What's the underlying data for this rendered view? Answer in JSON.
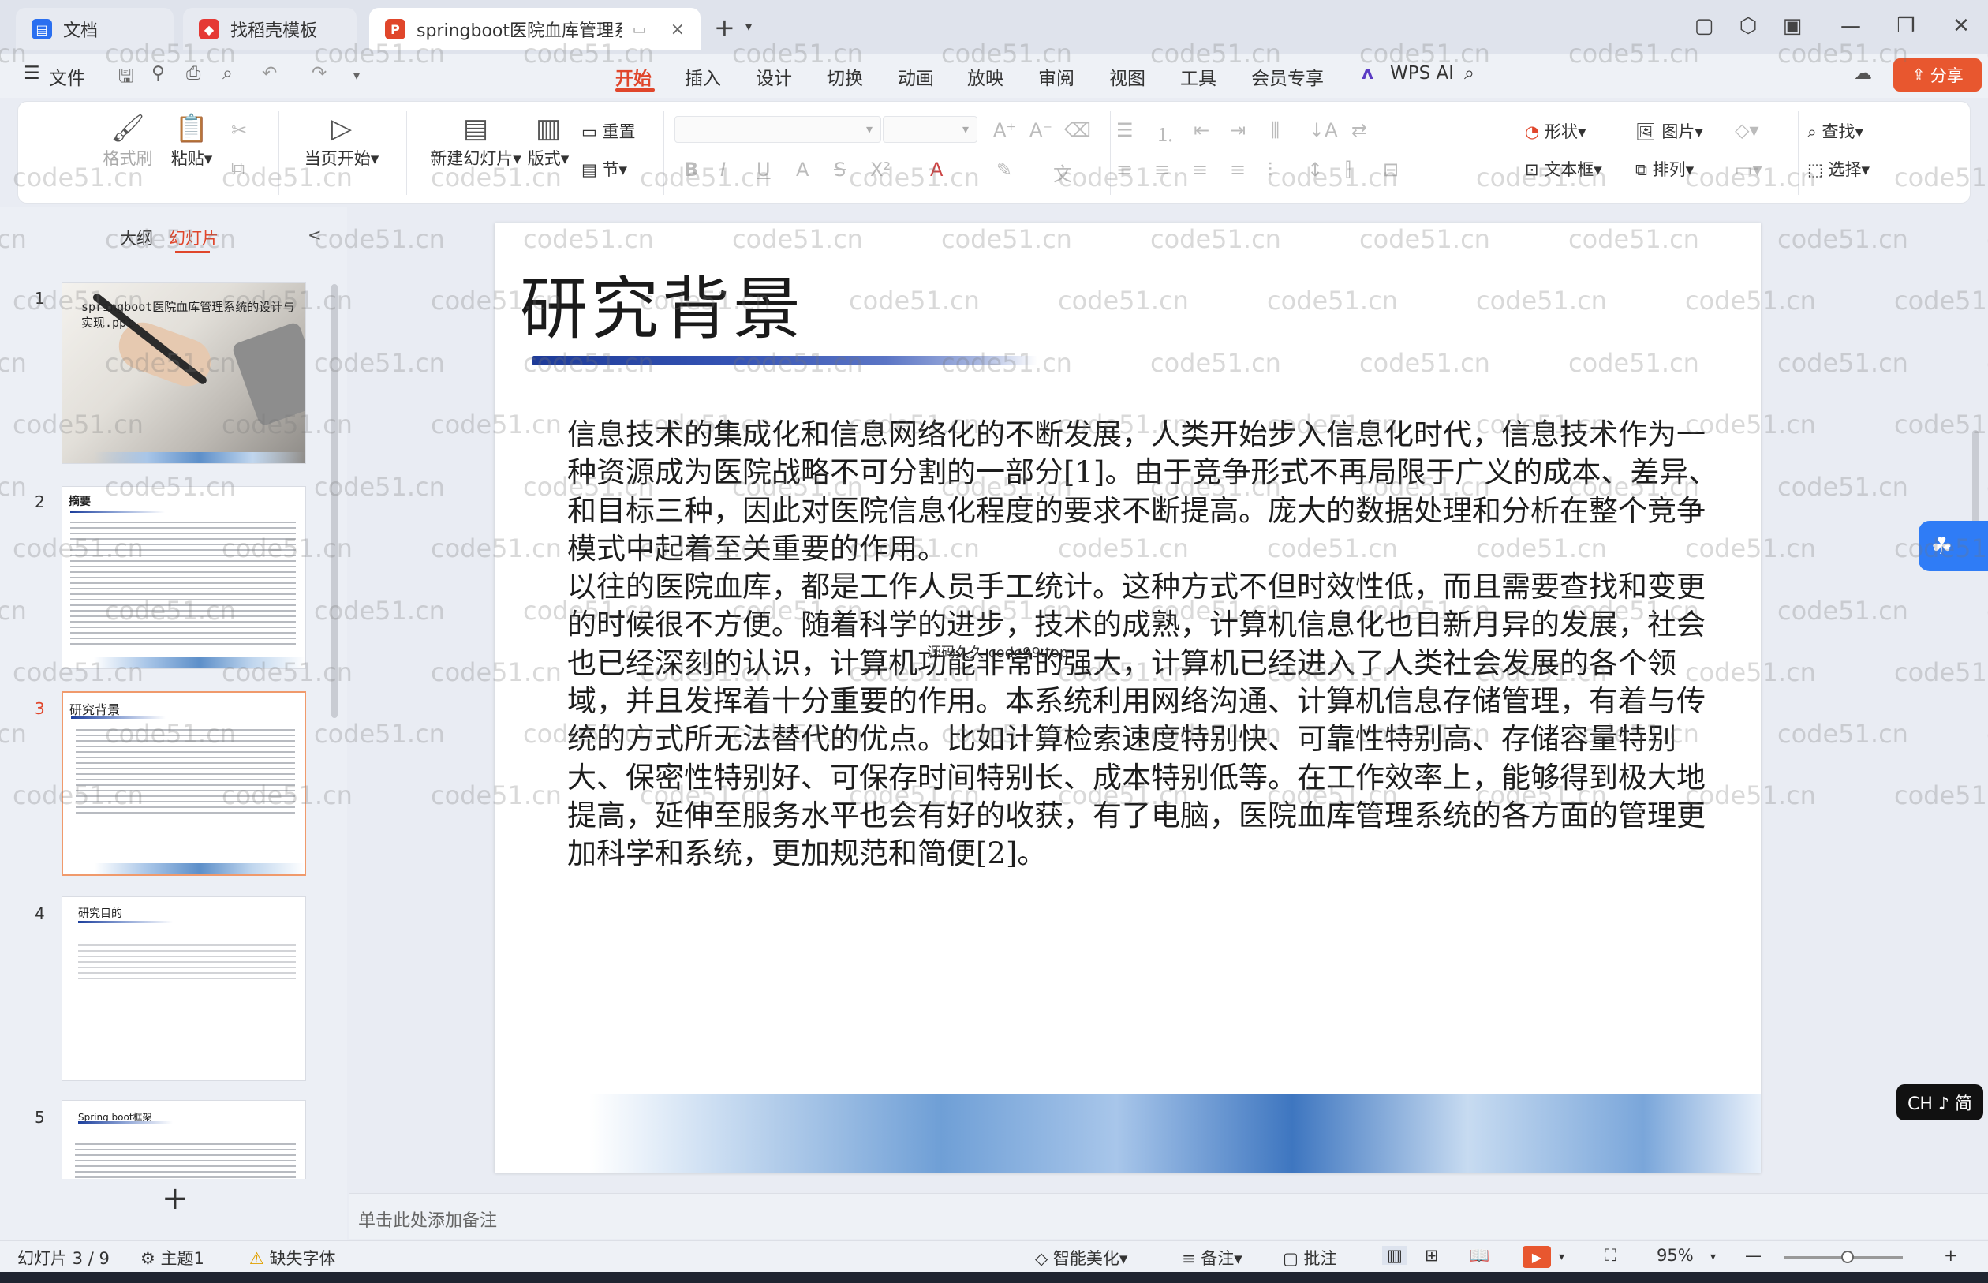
{
  "tabs": [
    {
      "label": "文档",
      "icon_color": "#2a6ff0"
    },
    {
      "label": "找稻壳模板",
      "icon_color": "#e53935"
    },
    {
      "label": "springboot医院血库管理系统",
      "icon_color": "#e0462b",
      "close": "×"
    }
  ],
  "new_tab": "+",
  "menu": {
    "file": "文件",
    "items": [
      "开始",
      "插入",
      "设计",
      "切换",
      "动画",
      "放映",
      "审阅",
      "视图",
      "工具",
      "会员专享"
    ],
    "wps_ai": "WPS AI",
    "share": "分享"
  },
  "ribbon": {
    "format_painter": "格式刷",
    "paste": "粘贴",
    "play_current": "当页开始",
    "new_slide": "新建幻灯片",
    "layout": "版式",
    "reset": "重置",
    "section": "节",
    "shape": "形状",
    "picture": "图片",
    "textbox": "文本框",
    "arrange": "排列",
    "find": "查找",
    "select": "选择"
  },
  "left_panel": {
    "tab_outline": "大纲",
    "tab_slides": "幻灯片",
    "collapse": "<",
    "slides": [
      {
        "num": "1",
        "title": "springboot医院血库管理系统的设计与实现.ppt"
      },
      {
        "num": "2",
        "title": "摘要"
      },
      {
        "num": "3",
        "title": "研究背景"
      },
      {
        "num": "4",
        "title": "研究目的"
      },
      {
        "num": "5",
        "title": "Spring boot框架"
      }
    ],
    "add": "+"
  },
  "slide": {
    "title": "研究背景",
    "paragraphs": [
      "信息技术的集成化和信息网络化的不断发展，人类开始步入信息化时代，信息技术作为一种资源成为医院战略不可分割的一部分[1]。由于竞争形式不再局限于广义的成本、差异、和目标三种，因此对医院信息化程度的要求不断提高。庞大的数据处理和分析在整个竞争模式中起着至关重要的作用。",
      "以往的医院血库，都是工作人员手工统计。这种方式不但时效性低，而且需要查找和变更的时候很不方便。随着科学的进步，技术的成熟，计算机信息化也日新月异的发展，社会也已经深刻的认识，计算机功能非常的强大，计算机已经进入了人类社会发展的各个领域，并且发挥着十分重要的作用。本系统利用网络沟通、计算机信息存储管理，有着与传统的方式所无法替代的优点。比如计算检索速度特别快、可靠性特别高、存储容量特别大、保密性特别好、可保存时间特别长、成本特别低等。在工作效率上，能够得到极大地提高，延伸至服务水平也会有好的收获，有了电脑，医院血库管理系统的各方面的管理更加科学和系统，更加规范和简便[2]。"
    ],
    "mark": "源码久久 code99.top"
  },
  "notes": "单击此处添加备注",
  "status": {
    "slide_index": "幻灯片 3 / 9",
    "theme": "主题1",
    "missing_font": "缺失字体",
    "beautify": "智能美化",
    "notes": "备注",
    "comment": "批注",
    "zoom": "95%"
  },
  "ime": "CH ♪ 简",
  "watermark": "code51.cn",
  "colors": {
    "accent": "#e0462b",
    "share": "#e8572f"
  }
}
